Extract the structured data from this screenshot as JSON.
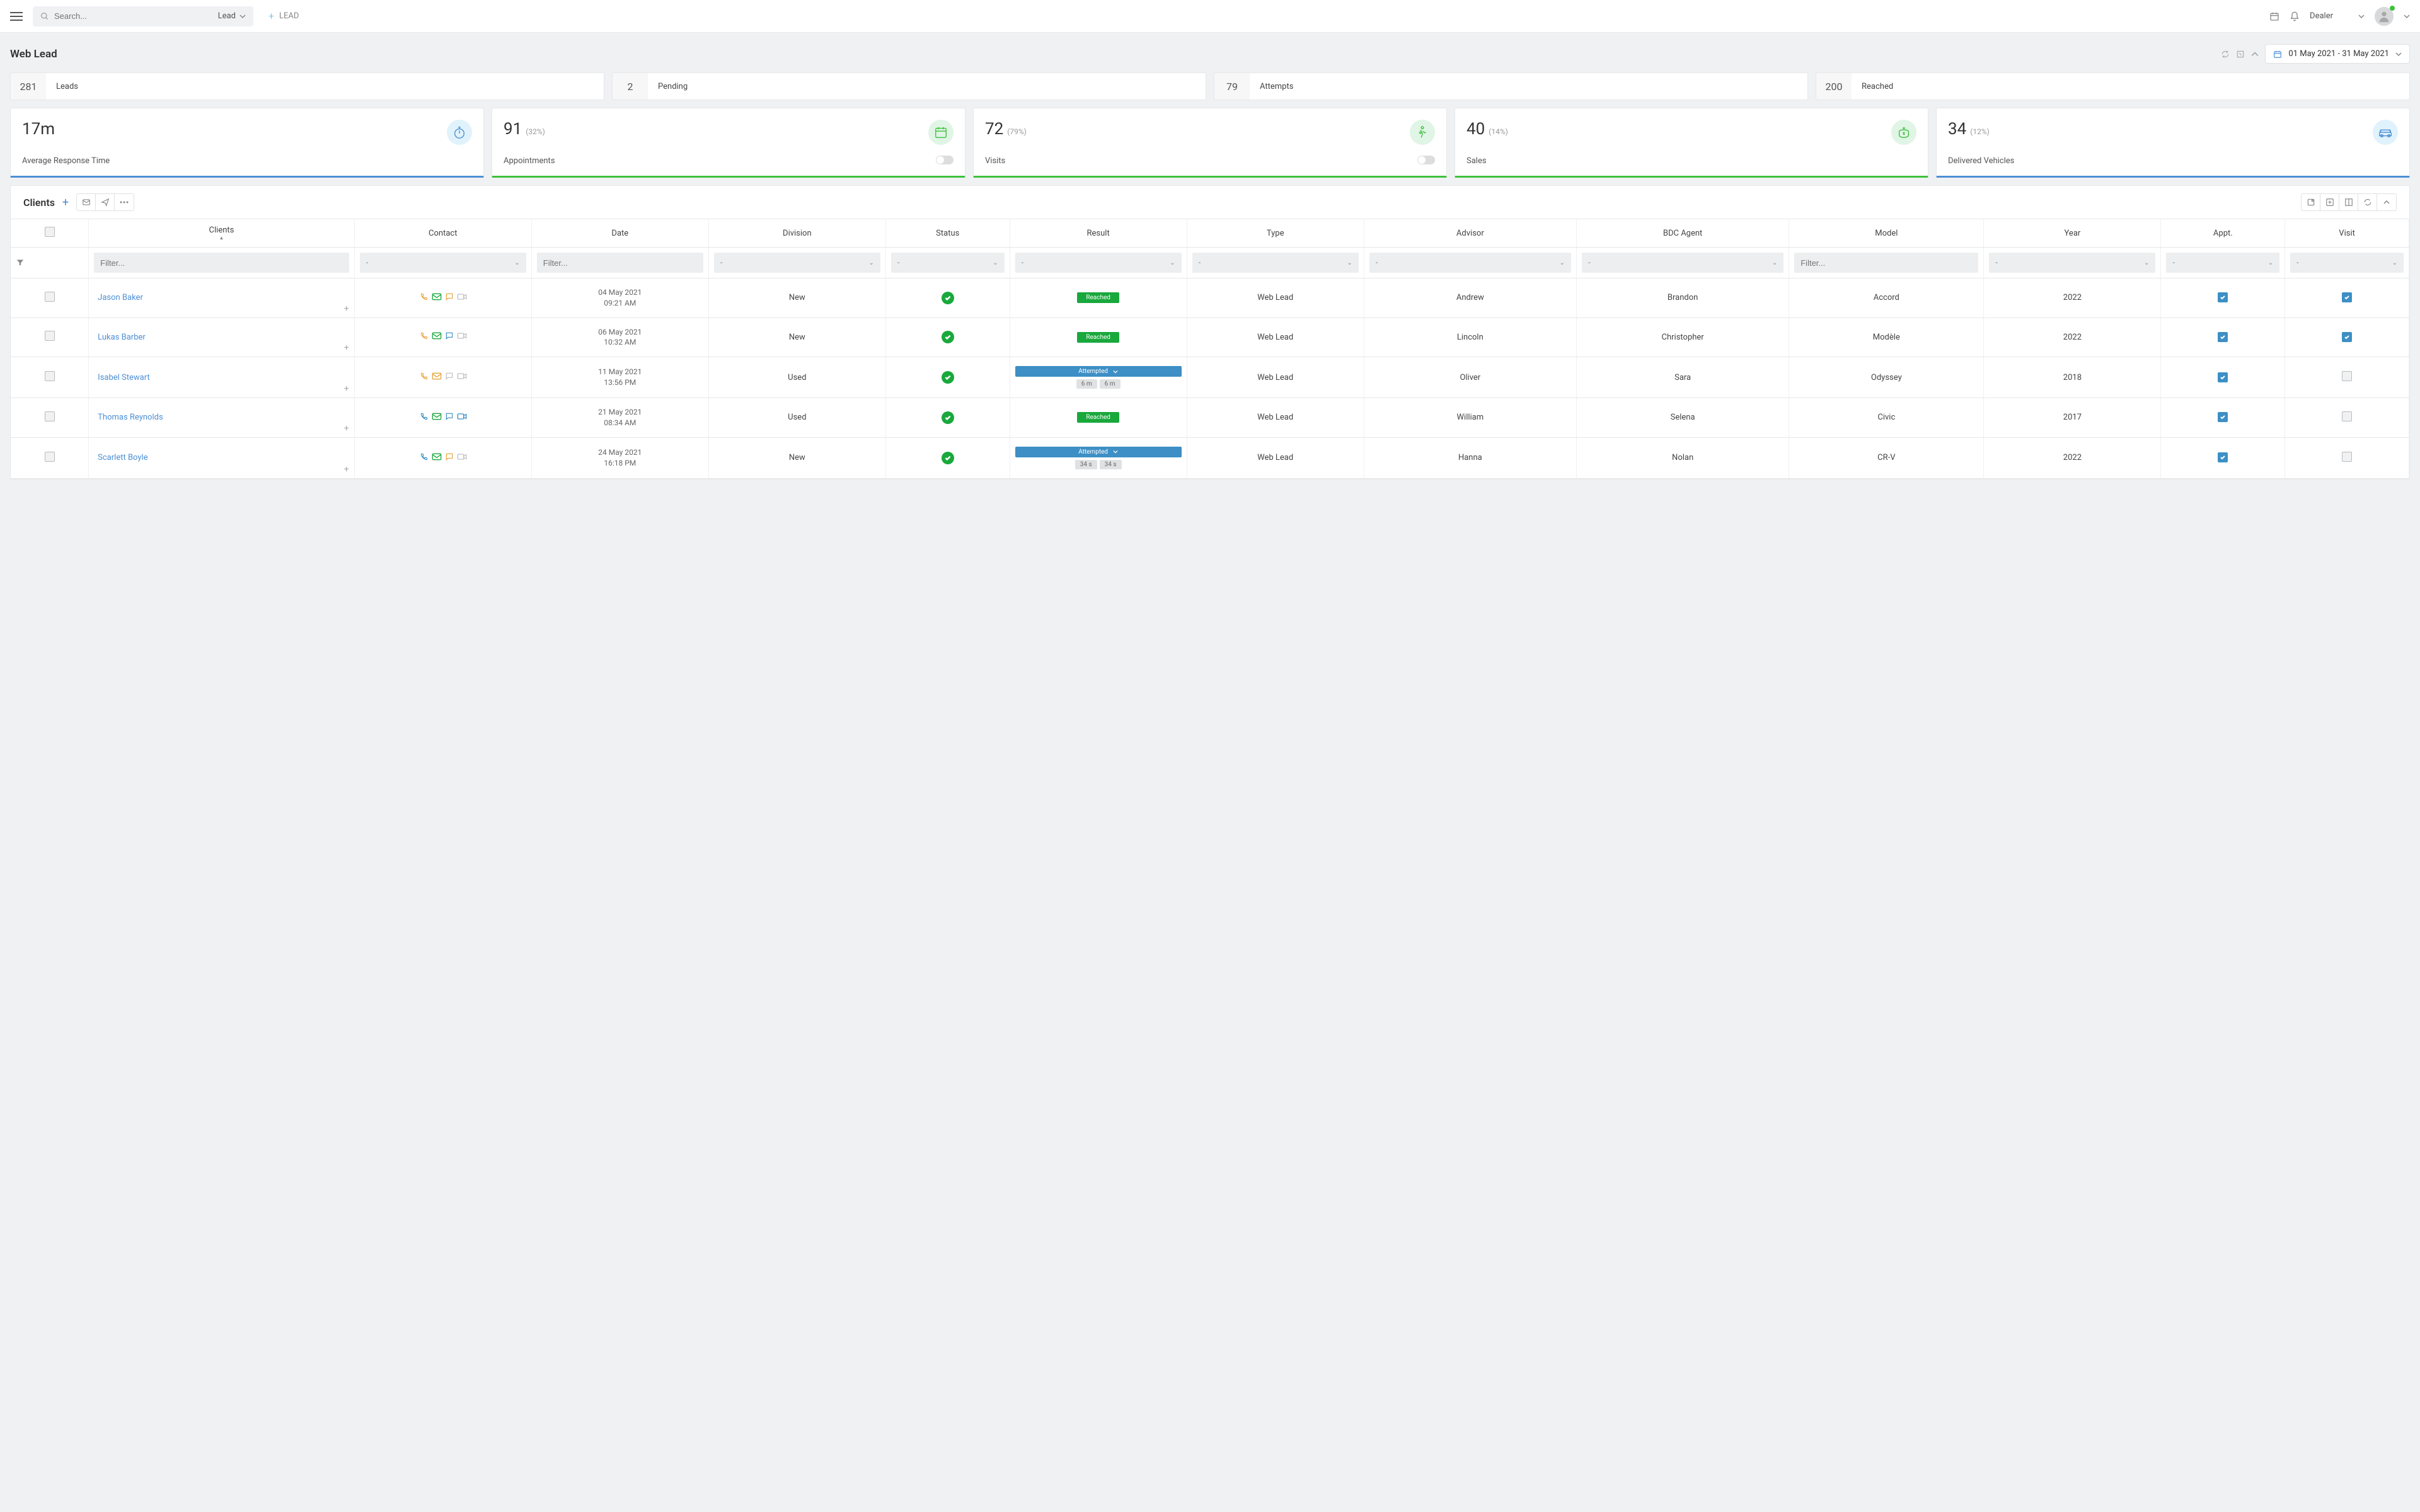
{
  "topbar": {
    "search_placeholder": "Search...",
    "search_type": "Lead",
    "lead_btn": "LEAD",
    "dealer_label": "Dealer"
  },
  "page_title": "Web Lead",
  "date_range": "01 May 2021 - 31 May 2021",
  "summary": [
    {
      "count": "281",
      "label": "Leads"
    },
    {
      "count": "2",
      "label": "Pending"
    },
    {
      "count": "79",
      "label": "Attempts"
    },
    {
      "count": "200",
      "label": "Reached"
    }
  ],
  "kpis": [
    {
      "value": "17m",
      "pct": "",
      "label": "Average Response Time",
      "color": "blue",
      "toggle": false,
      "icon": "stopwatch"
    },
    {
      "value": "91",
      "pct": "(32%)",
      "label": "Appointments",
      "color": "green",
      "toggle": true,
      "icon": "calendar"
    },
    {
      "value": "72",
      "pct": "(79%)",
      "label": "Visits",
      "color": "green",
      "toggle": true,
      "icon": "walk"
    },
    {
      "value": "40",
      "pct": "(14%)",
      "label": "Sales",
      "color": "green",
      "toggle": false,
      "icon": "money"
    },
    {
      "value": "34",
      "pct": "(12%)",
      "label": "Delivered Vehicles",
      "color": "blue",
      "toggle": false,
      "icon": "car"
    }
  ],
  "table": {
    "title": "Clients",
    "columns": [
      "Clients",
      "Contact",
      "Date",
      "Division",
      "Status",
      "Result",
      "Type",
      "Advisor",
      "BDC Agent",
      "Model",
      "Year",
      "Appt.",
      "Visit"
    ],
    "filter_placeholder": "Filter...",
    "rows": [
      {
        "client": "Jason Baker",
        "contact": {
          "phone": "orange",
          "mail": "green",
          "chat": "orange",
          "video": "grey"
        },
        "date": "04 May 2021",
        "time": "09:21 AM",
        "division": "New",
        "result": {
          "kind": "reached",
          "label": "Reached"
        },
        "type": "Web Lead",
        "advisor": "Andrew",
        "bdc": "Brandon",
        "model": "Accord",
        "year": "2022",
        "appt": true,
        "visit": true
      },
      {
        "client": "Lukas Barber",
        "contact": {
          "phone": "orange",
          "mail": "green",
          "chat": "blue",
          "video": "grey"
        },
        "date": "06 May 2021",
        "time": "10:32 AM",
        "division": "New",
        "result": {
          "kind": "reached",
          "label": "Reached"
        },
        "type": "Web Lead",
        "advisor": "Lincoln",
        "bdc": "Christopher",
        "model": "Modèle",
        "year": "2022",
        "appt": true,
        "visit": true
      },
      {
        "client": "Isabel Stewart",
        "contact": {
          "phone": "orange",
          "mail": "orange",
          "chat": "grey",
          "video": "grey"
        },
        "date": "11 May 2021",
        "time": "13:56 PM",
        "division": "Used",
        "result": {
          "kind": "attempted",
          "label": "Attempted",
          "t1": "6 m",
          "t2": "6 m"
        },
        "type": "Web Lead",
        "advisor": "Oliver",
        "bdc": "Sara",
        "model": "Odyssey",
        "year": "2018",
        "appt": true,
        "visit": false
      },
      {
        "client": "Thomas Reynolds",
        "contact": {
          "phone": "blue",
          "mail": "green",
          "chat": "blue",
          "video": "blue"
        },
        "date": "21 May 2021",
        "time": "08:34 AM",
        "division": "Used",
        "result": {
          "kind": "reached",
          "label": "Reached"
        },
        "type": "Web Lead",
        "advisor": "William",
        "bdc": "Selena",
        "model": "Civic",
        "year": "2017",
        "appt": true,
        "visit": false
      },
      {
        "client": "Scarlett Boyle",
        "contact": {
          "phone": "blue",
          "mail": "green",
          "chat": "orange",
          "video": "grey"
        },
        "date": "24 May 2021",
        "time": "16:18 PM",
        "division": "New",
        "result": {
          "kind": "attempted",
          "label": "Attempted",
          "t1": "34 s",
          "t2": "34 s"
        },
        "type": "Web Lead",
        "advisor": "Hanna",
        "bdc": "Nolan",
        "model": "CR-V",
        "year": "2022",
        "appt": true,
        "visit": false
      }
    ]
  },
  "icon_colors": {
    "orange": "#e8a33b",
    "green": "#19a83c",
    "blue": "#3d8fc5",
    "grey": "#c0c0c0"
  }
}
